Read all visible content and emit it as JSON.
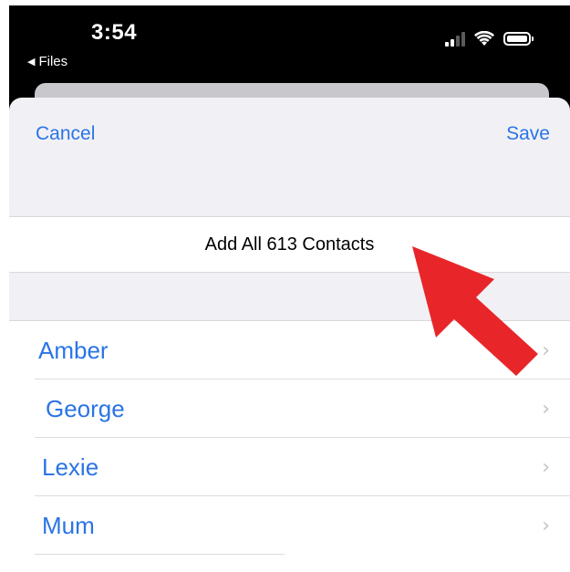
{
  "status_bar": {
    "time": "3:54",
    "back_app": "Files",
    "back_arrow": "◀"
  },
  "nav": {
    "cancel_label": "Cancel",
    "save_label": "Save"
  },
  "add_all_label": "Add All 613 Contacts",
  "contacts": [
    {
      "name": "Amber"
    },
    {
      "name": "George"
    },
    {
      "name": "Lexie"
    },
    {
      "name": "Mum"
    }
  ],
  "chevron": "›",
  "colors": {
    "accent": "#2b74e6",
    "annotation_arrow": "#e8262a",
    "sheet_background": "#f1f1f5"
  },
  "icons": {
    "signal": "cellular-signal-icon",
    "wifi": "wifi-icon",
    "battery": "battery-icon",
    "chevron": "chevron-right-icon",
    "annotation": "red-arrow-annotation"
  }
}
